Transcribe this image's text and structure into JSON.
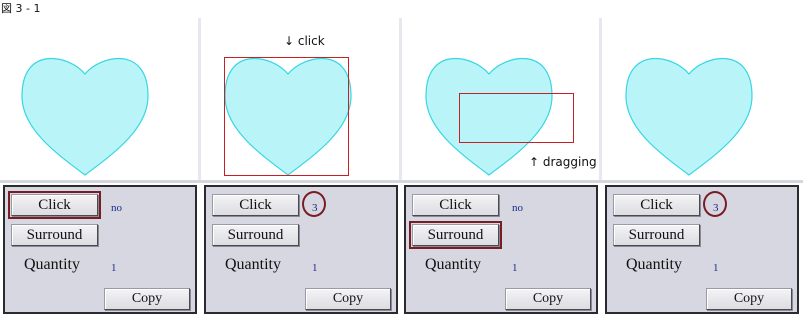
{
  "figure": {
    "title": "図 3 - 1"
  },
  "annotations": {
    "click": "↓ click",
    "dragging": "↑ dragging"
  },
  "colors": {
    "heart_fill": "#b9f5f8",
    "heart_stroke": "#36d6e2",
    "selection": "#c62024",
    "highlight_ring": "#7a1c24",
    "panel_bg": "#d7d7e1"
  },
  "panels": [
    {
      "click_label": "Click",
      "surround_label": "Surround",
      "quantity_label": "Quantity",
      "copy_label": "Copy",
      "click_value": "no",
      "quantity_value": "1",
      "highlight": "click-button"
    },
    {
      "click_label": "Click",
      "surround_label": "Surround",
      "quantity_label": "Quantity",
      "copy_label": "Copy",
      "click_value": "3",
      "quantity_value": "1",
      "highlight": "click-value"
    },
    {
      "click_label": "Click",
      "surround_label": "Surround",
      "quantity_label": "Quantity",
      "copy_label": "Copy",
      "click_value": "no",
      "quantity_value": "1",
      "highlight": "surround-button"
    },
    {
      "click_label": "Click",
      "surround_label": "Surround",
      "quantity_label": "Quantity",
      "copy_label": "Copy",
      "click_value": "3",
      "quantity_value": "1",
      "highlight": "click-value"
    }
  ]
}
